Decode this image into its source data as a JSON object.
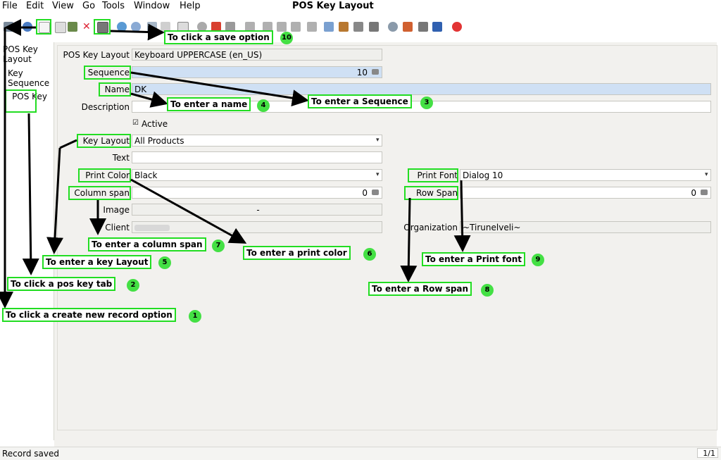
{
  "window": {
    "title": "POS Key Layout"
  },
  "menu": {
    "file": "File",
    "edit": "Edit",
    "view": "View",
    "go": "Go",
    "tools": "Tools",
    "window": "Window",
    "help": "Help"
  },
  "tabs": {
    "pos_key_layout": "POS Key Layout",
    "key_sequence": "Key Sequence",
    "pos_key": "POS Key"
  },
  "form": {
    "pos_key_layout_label": "POS Key Layout",
    "pos_key_layout_value": "Keyboard UPPERCASE (en_US)",
    "sequence_label": "Sequence",
    "sequence_value": "10",
    "name_label": "Name",
    "name_value": "DK",
    "description_label": "Description",
    "description_value": "",
    "active_label": "Active",
    "key_layout_label": "Key Layout",
    "key_layout_value": "All Products",
    "text_label": "Text",
    "text_value": "",
    "print_color_label": "Print Color",
    "print_color_value": "Black",
    "print_font_label": "Print Font",
    "print_font_value": "Dialog 10",
    "column_span_label": "Column span",
    "column_span_value": "0",
    "row_span_label": "Row Span",
    "row_span_value": "0",
    "image_label": "Image",
    "image_value": "-",
    "client_label": "Client",
    "organization_label": "Organization",
    "organization_value": "~Tirunelveli~"
  },
  "annotations": {
    "a1": "To click a create new record option",
    "n1": "1",
    "a2": "To click a pos key tab",
    "n2": "2",
    "a3": "To enter a Sequence",
    "n3": "3",
    "a4": "To enter a name",
    "n4": "4",
    "a5": "To enter a key Layout",
    "n5": "5",
    "a6": "To enter a print color",
    "n6": "6",
    "a7": "To enter a column span",
    "n7": "7",
    "a8": "To enter a Row span",
    "n8": "8",
    "a9": "To enter a Print font",
    "n9": "9",
    "a10": "To click a save option",
    "n10": "10"
  },
  "status": {
    "message": "Record saved",
    "page": "1/1"
  },
  "colors": {
    "annotation_green": "#22dd22",
    "mandatory_field": "#cfe0f4",
    "delete_red": "#e23434"
  }
}
